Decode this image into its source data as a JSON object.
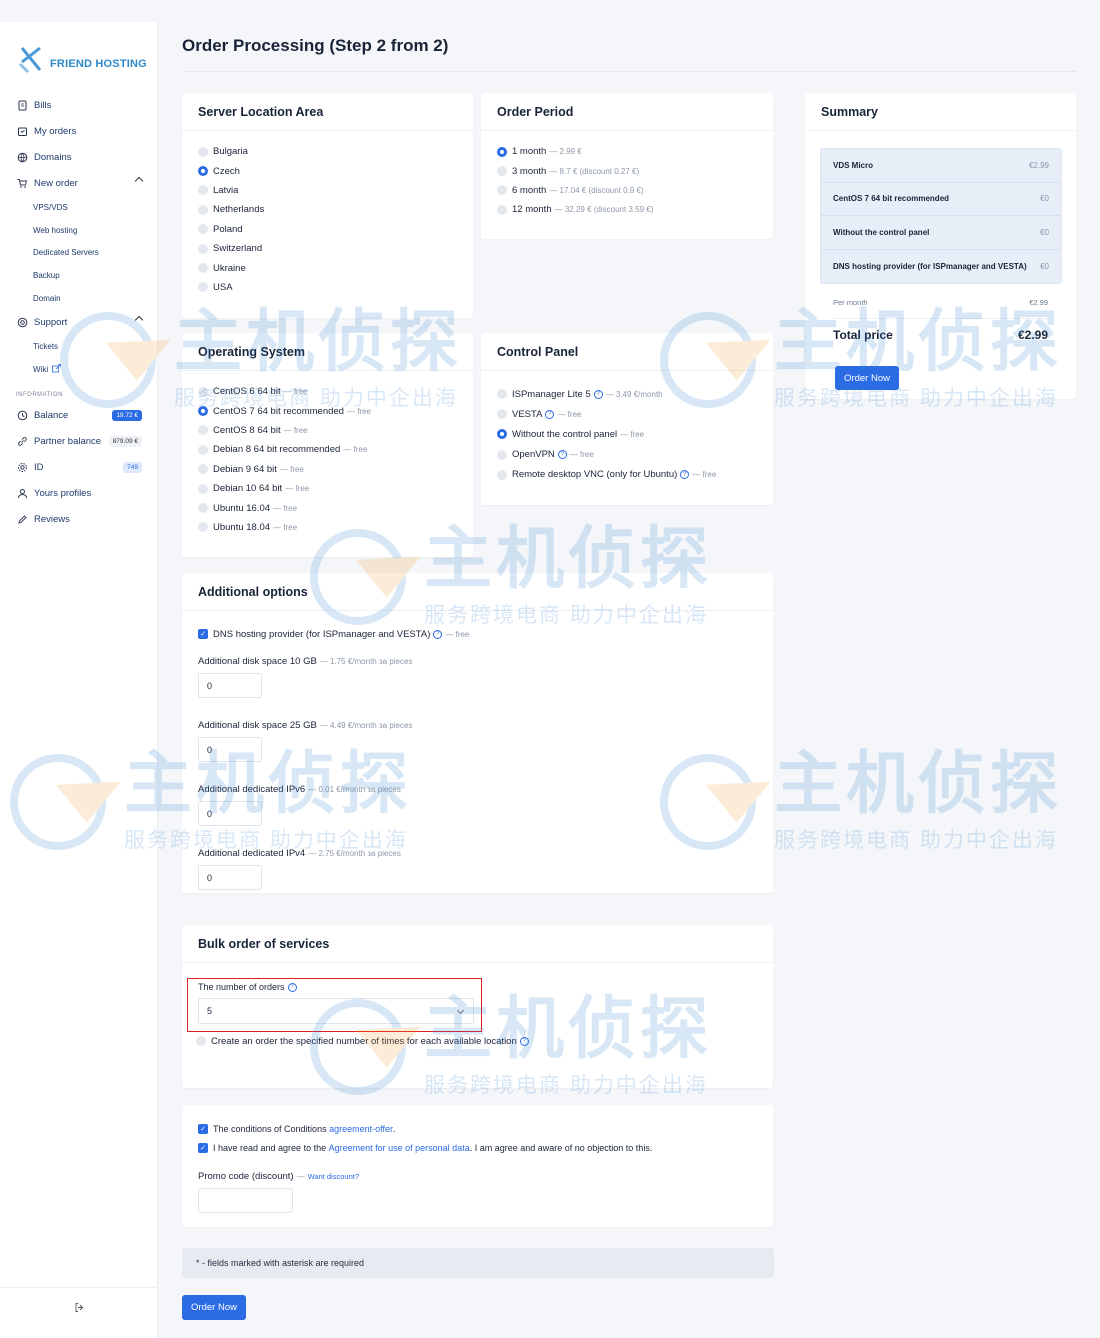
{
  "brand": {
    "name": "FRIEND HOSTING"
  },
  "sidebar": {
    "items": [
      {
        "label": "Bills",
        "icon": "document-icon"
      },
      {
        "label": "My orders",
        "icon": "orders-icon"
      },
      {
        "label": "Domains",
        "icon": "globe-icon"
      },
      {
        "label": "New order",
        "icon": "cart-icon"
      }
    ],
    "new_order_sub": [
      "VPS/VDS",
      "Web hosting",
      "Dedicated Servers",
      "Backup",
      "Domain"
    ],
    "support": {
      "label": "Support",
      "icon": "support-icon"
    },
    "support_sub": [
      "Tickets",
      "Wiki"
    ],
    "section_title": "INFORMATION",
    "info_items": [
      {
        "label": "Balance",
        "badge": "19.72 €",
        "icon": "clock-icon"
      },
      {
        "label": "Partner balance",
        "badge": "879.09 €",
        "icon": "link-icon"
      },
      {
        "label": "ID",
        "badge": "749",
        "icon": "gear-icon"
      },
      {
        "label": "Yours profiles",
        "icon": "user-icon"
      },
      {
        "label": "Reviews",
        "icon": "pencil-icon"
      }
    ]
  },
  "page": {
    "title": "Order Processing (Step 2 from 2)"
  },
  "location": {
    "title": "Server Location Area",
    "options": [
      "Bulgaria",
      "Czech",
      "Latvia",
      "Netherlands",
      "Poland",
      "Switzerland",
      "Ukraine",
      "USA"
    ],
    "selected": "Czech"
  },
  "period": {
    "title": "Order Period",
    "options": [
      {
        "label": "1 month",
        "note": "— 2.99 €"
      },
      {
        "label": "3 month",
        "note": "— 8.7 € (discount 0.27 €)"
      },
      {
        "label": "6 month",
        "note": "— 17.04 € (discount 0.9 €)"
      },
      {
        "label": "12 month",
        "note": "— 32.29 € (discount 3.59 €)"
      }
    ],
    "selected": "1 month"
  },
  "os": {
    "title": "Operating System",
    "options": [
      {
        "label": "CentOS 6 64 bit",
        "note": "— free"
      },
      {
        "label": "CentOS 7 64 bit recommended",
        "note": "— free"
      },
      {
        "label": "CentOS 8 64 bit",
        "note": "— free"
      },
      {
        "label": "Debian 8 64 bit recommended",
        "note": "— free"
      },
      {
        "label": "Debian 9 64 bit",
        "note": "— free"
      },
      {
        "label": "Debian 10 64 bit",
        "note": "— free"
      },
      {
        "label": "Ubuntu 16.04",
        "note": "— free"
      },
      {
        "label": "Ubuntu 18.04",
        "note": "— free"
      }
    ],
    "selected": "CentOS 7 64 bit recommended"
  },
  "panel": {
    "title": "Control Panel",
    "options": [
      {
        "label": "ISPmanager Lite 5",
        "note": "— 3.49 €/month"
      },
      {
        "label": "VESTA",
        "note": "— free"
      },
      {
        "label": "Without the control panel",
        "note": "— free"
      },
      {
        "label": "OpenVPN",
        "note": "— free"
      },
      {
        "label": "Remote desktop VNC (only for Ubuntu)",
        "note": "— free"
      }
    ],
    "selected": "Without the control panel"
  },
  "summary": {
    "title": "Summary",
    "rows": [
      {
        "label": "VDS Micro",
        "price": "€2.99"
      },
      {
        "label": "CentOS 7 64 bit recommended",
        "price": "€0"
      },
      {
        "label": "Without the control panel",
        "price": "€0"
      },
      {
        "label": "DNS hosting provider (for ISPmanager and VESTA)",
        "price": "€0"
      }
    ],
    "per_month_label": "Per month",
    "per_month_value": "€2.99",
    "total_label": "Total price",
    "total_value": "€2.99",
    "order_button": "Order Now"
  },
  "additional": {
    "title": "Additional options",
    "dns_label": "DNS hosting provider (for ISPmanager and VESTA)",
    "dns_note": "— free",
    "fields": [
      {
        "label": "Additional disk space 10 GB",
        "note": "— 1.75 €/month за pieces",
        "value": "0"
      },
      {
        "label": "Additional disk space 25 GB",
        "note": "— 4.49 €/month за pieces",
        "value": "0"
      },
      {
        "label": "Additional dedicated IPv6",
        "note": "— 0.01 €/month за pieces",
        "value": "0"
      },
      {
        "label": "Additional dedicated IPv4",
        "note": "— 2.75 €/month за pieces",
        "value": "0"
      }
    ]
  },
  "bulk": {
    "title": "Bulk order of services",
    "orders_label": "The number of orders",
    "orders_value": "5",
    "each_location_label": "Create an order the specified number of times for each available location"
  },
  "terms": {
    "conditions_prefix": "The conditions of Conditions",
    "conditions_link": "agreement-offer",
    "conditions_suffix": ".",
    "agree_prefix": "I have read and agree to the",
    "agree_link": "Agreement for use of personal data",
    "agree_suffix": ". I am agree and aware of no objection to this.",
    "promo_label": "Promo code (discount)",
    "promo_dash": "—",
    "promo_link": "Want discount?"
  },
  "notice": "* - fields marked with asterisk are required",
  "footer": {
    "order_button": "Order Now"
  },
  "watermark": {
    "big": "主机侦探",
    "small": "服务跨境电商 助力中企出海"
  },
  "colors": {
    "accent": "#2b6be3",
    "highlight": "#e02020"
  }
}
